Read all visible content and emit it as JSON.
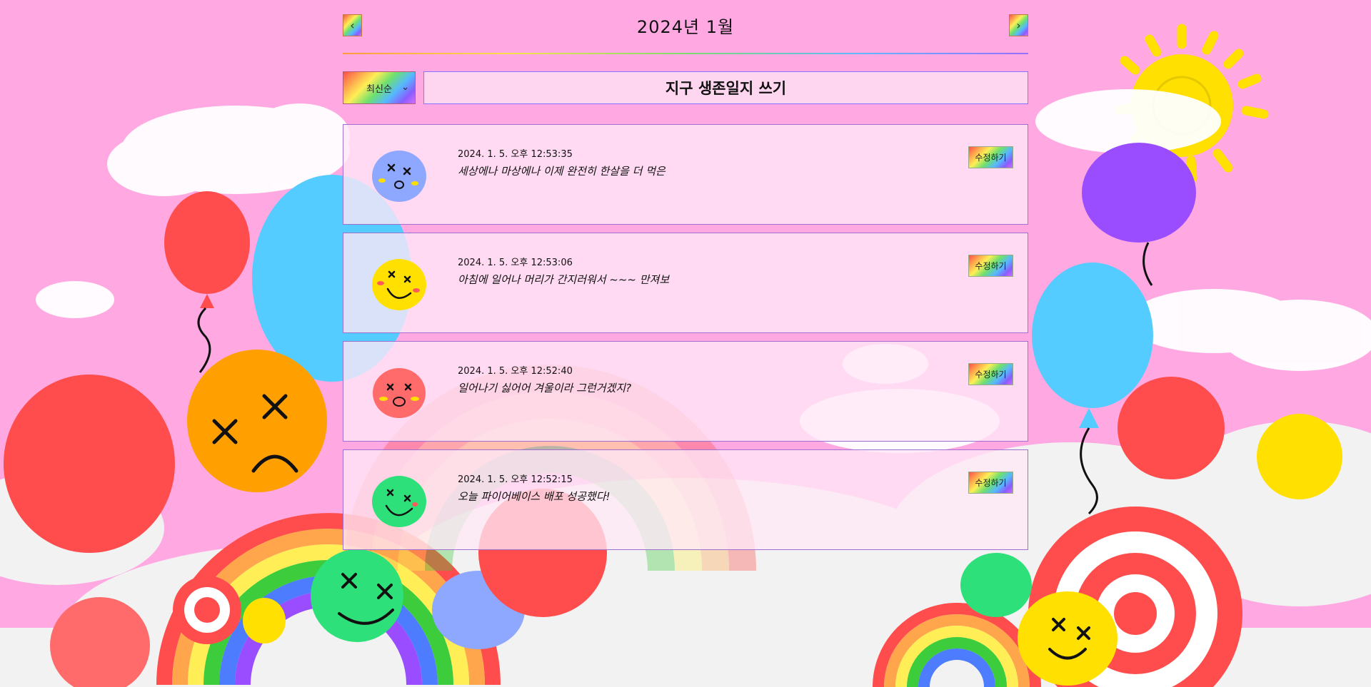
{
  "header": {
    "prev_icon": "chevron-left-icon",
    "prev_glyph": "‹",
    "title": "2024년 1월",
    "next_icon": "chevron-right-icon",
    "next_glyph": "›"
  },
  "toolbar": {
    "sort_selected": "최신순",
    "sort_icon": "chevron-down-icon",
    "sort_glyph": "⌄",
    "write_label": "지구 생존일지 쓰기"
  },
  "entries": [
    {
      "emotion_icon": "dizzy-face-icon",
      "date": "2024. 1. 5. 오후 12:53:35",
      "content": "세상에나 마상에나 이제 완전히 한살을 더 먹은",
      "edit_label": "수정하기"
    },
    {
      "emotion_icon": "dizzy-smile-face-icon",
      "date": "2024. 1. 5. 오후 12:53:06",
      "content": "아침에 일어나 머리가 간지러워서 ~~~ 만져보",
      "edit_label": "수정하기"
    },
    {
      "emotion_icon": "dizzy-shocked-face-icon",
      "date": "2024. 1. 5. 오후 12:52:40",
      "content": "일어나기 싫어어 겨울이라 그런거겠지?",
      "edit_label": "수정하기"
    },
    {
      "emotion_icon": "dizzy-grin-face-icon",
      "date": "2024. 1. 5. 오후 12:52:15",
      "content": "오늘 파이어베이스 배포 성공했다!",
      "edit_label": "수정하기"
    }
  ],
  "colors": {
    "background": "#ffa8e2",
    "card_border": "#a070d0",
    "write_button_bg": "#ffd6f0"
  }
}
